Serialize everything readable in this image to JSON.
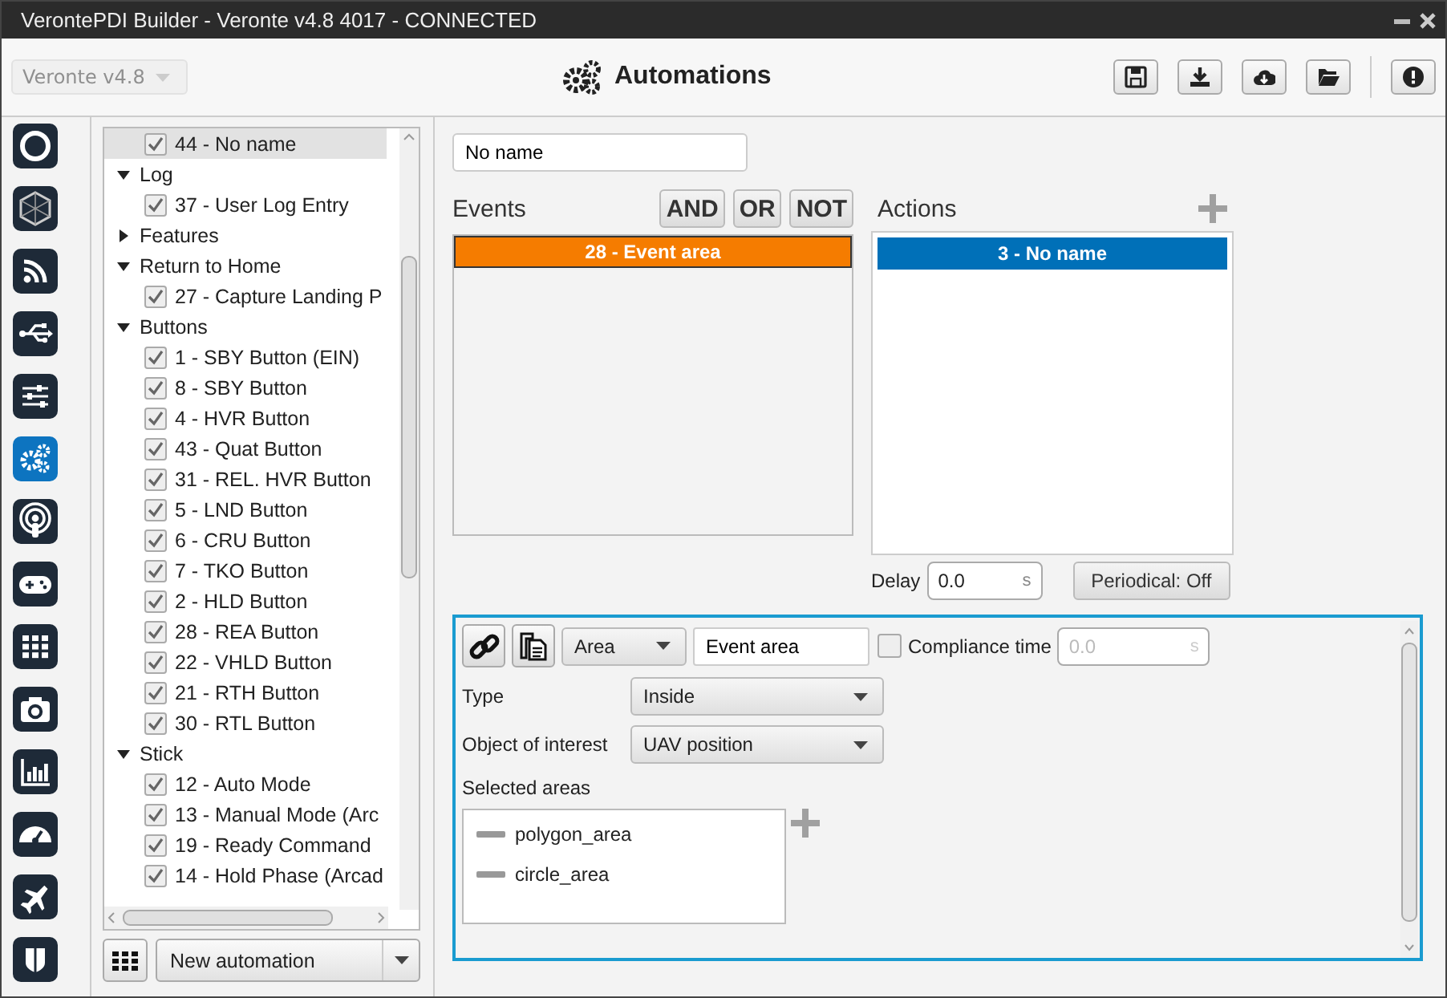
{
  "window": {
    "title": "VerontePDI Builder - Veronte v4.8 4017 - CONNECTED"
  },
  "toolbar": {
    "device": "Veronte v4.8",
    "title": "Automations"
  },
  "rail": [
    {
      "selected": false
    },
    {
      "selected": false
    },
    {
      "selected": false
    },
    {
      "selected": false
    },
    {
      "selected": false
    },
    {
      "selected": true
    },
    {
      "selected": false
    },
    {
      "selected": false
    },
    {
      "selected": false
    },
    {
      "selected": false
    },
    {
      "selected": false
    },
    {
      "selected": false
    },
    {
      "selected": false
    },
    {
      "selected": false
    }
  ],
  "tree": [
    {
      "children": [
        {
          "label": "44 - No name",
          "checked": true,
          "selected": true
        }
      ]
    },
    {
      "label": "Log",
      "expanded": true,
      "children": [
        {
          "label": "37 - User Log Entry",
          "checked": true,
          "selected": false
        }
      ]
    },
    {
      "label": "Features",
      "expanded": false
    },
    {
      "label": "Return to Home",
      "expanded": true,
      "children": [
        {
          "label": "27 - Capture Landing P",
          "checked": true,
          "selected": false
        }
      ]
    },
    {
      "label": "Buttons",
      "expanded": true,
      "children": [
        {
          "label": "1 - SBY Button (EIN)",
          "checked": true,
          "selected": false
        },
        {
          "label": "8 - SBY Button",
          "checked": true,
          "selected": false
        },
        {
          "label": "4 - HVR Button",
          "checked": true,
          "selected": false
        },
        {
          "label": "43 - Quat Button",
          "checked": true,
          "selected": false
        },
        {
          "label": "31 - REL. HVR Button",
          "checked": true,
          "selected": false
        },
        {
          "label": "5 - LND Button",
          "checked": true,
          "selected": false
        },
        {
          "label": "6 - CRU Button",
          "checked": true,
          "selected": false
        },
        {
          "label": "7 - TKO Button",
          "checked": true,
          "selected": false
        },
        {
          "label": "2 - HLD Button",
          "checked": true,
          "selected": false
        },
        {
          "label": "28 - REA Button",
          "checked": true,
          "selected": false
        },
        {
          "label": "22 - VHLD Button",
          "checked": true,
          "selected": false
        },
        {
          "label": "21 - RTH Button",
          "checked": true,
          "selected": false
        },
        {
          "label": "30 - RTL Button",
          "checked": true,
          "selected": false
        }
      ]
    },
    {
      "label": "Stick",
      "expanded": true,
      "children": [
        {
          "label": "12 - Auto Mode",
          "checked": true,
          "selected": false
        },
        {
          "label": "13 - Manual Mode (Arc",
          "checked": true,
          "selected": false
        },
        {
          "label": "19 - Ready Command",
          "checked": true,
          "selected": false
        },
        {
          "label": "14 - Hold Phase (Arcad",
          "checked": true,
          "selected": false
        }
      ]
    }
  ],
  "new_automation": "New automation",
  "automation": {
    "name": "No name",
    "events_label": "Events",
    "operators": [
      "AND",
      "OR",
      "NOT"
    ],
    "events": [
      {
        "label": "28 - Event area",
        "selected": true
      }
    ],
    "actions_label": "Actions",
    "actions": [
      {
        "label": "3 - No name",
        "selected": false
      }
    ],
    "delay": {
      "label": "Delay",
      "value": "0.0",
      "unit": "s"
    },
    "periodical": "Periodical: Off"
  },
  "event_detail": {
    "kind": "Area",
    "name": "Event area",
    "compliance": {
      "label": "Compliance time",
      "checked": false,
      "value": "0.0",
      "unit": "s"
    },
    "fields": [
      {
        "label": "Type",
        "value": "Inside"
      },
      {
        "label": "Object of interest",
        "value": "UAV position"
      }
    ],
    "areas_label": "Selected areas",
    "areas": [
      {
        "name": "polygon_area"
      },
      {
        "name": "circle_area"
      }
    ]
  }
}
